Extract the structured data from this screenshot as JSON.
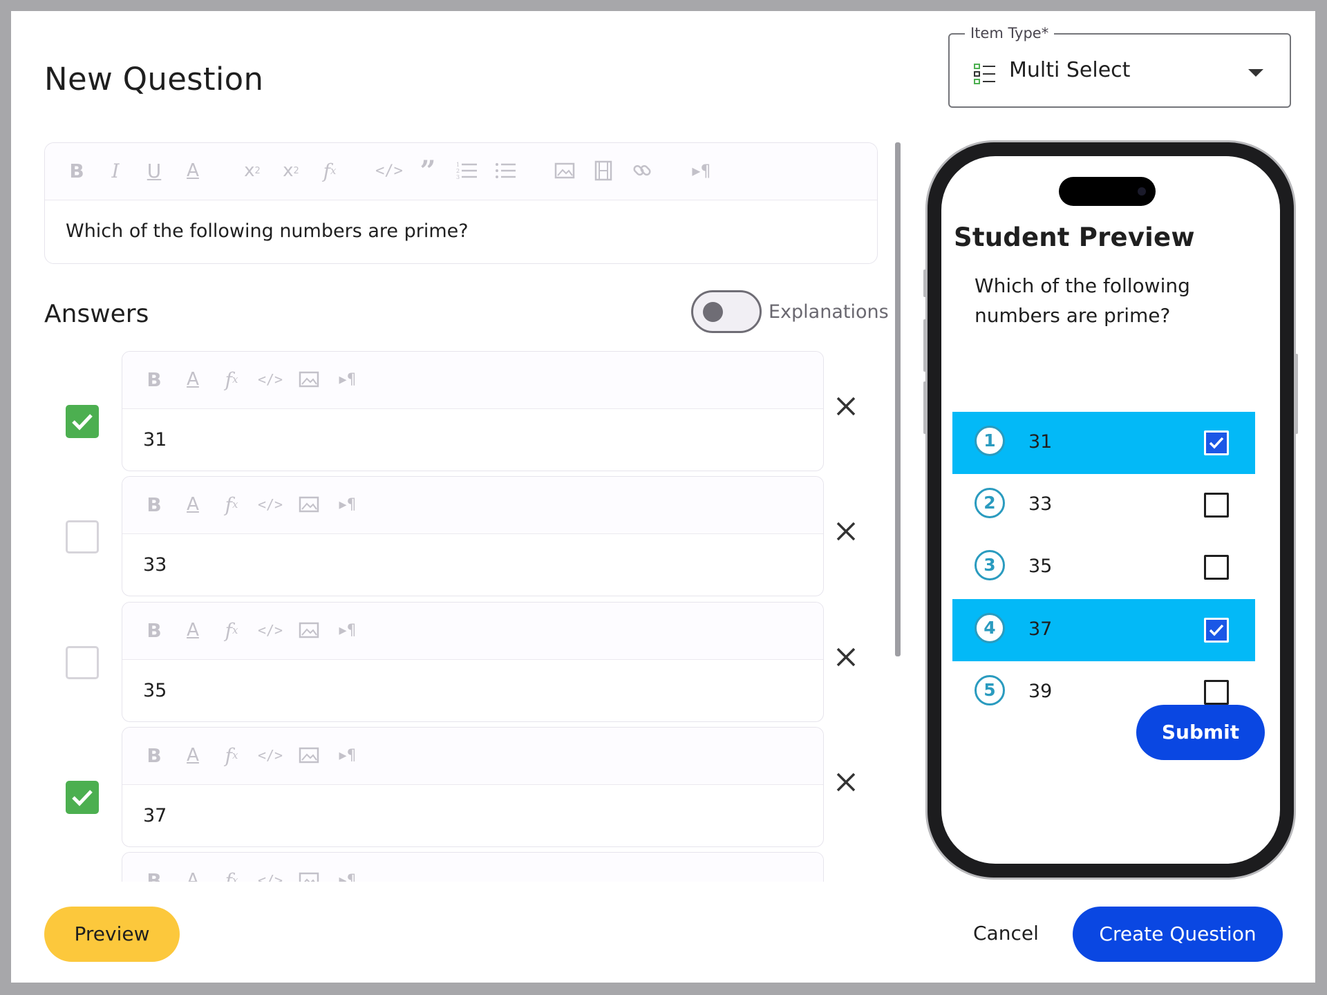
{
  "dialog": {
    "title": "New Question",
    "item_type": {
      "legend": "Item Type*",
      "value": "Multi Select",
      "icon": "multi-select-list-icon"
    }
  },
  "question": {
    "text": "Which of the following numbers are prime?",
    "toolbar": [
      "bold",
      "italic",
      "underline",
      "text-color",
      "subscript",
      "superscript",
      "formula",
      "code",
      "quote",
      "numbered-list",
      "bulleted-list",
      "image",
      "video",
      "link",
      "text-direction"
    ]
  },
  "answers": {
    "title": "Answers",
    "explanations_label": "Explanations",
    "explanations_on": false,
    "items": [
      {
        "value": "31",
        "correct": true
      },
      {
        "value": "33",
        "correct": false
      },
      {
        "value": "35",
        "correct": false
      },
      {
        "value": "37",
        "correct": true
      }
    ],
    "answer_toolbar": [
      "bold",
      "text-color",
      "formula",
      "code",
      "image",
      "text-direction"
    ]
  },
  "preview": {
    "title": "Student Preview",
    "question": "Which of the following numbers are prime?",
    "options": [
      {
        "num": "1",
        "value": "31",
        "selected": true
      },
      {
        "num": "2",
        "value": "33",
        "selected": false
      },
      {
        "num": "3",
        "value": "35",
        "selected": false
      },
      {
        "num": "4",
        "value": "37",
        "selected": true
      },
      {
        "num": "5",
        "value": "39",
        "selected": false
      }
    ],
    "submit": "Submit",
    "highlight_color": "#03b9f7"
  },
  "footer": {
    "preview": "Preview",
    "cancel": "Cancel",
    "create": "Create Question"
  },
  "colors": {
    "primary": "#0a47e2",
    "preview_button": "#fcc83c",
    "correct_check": "#4caf50"
  }
}
